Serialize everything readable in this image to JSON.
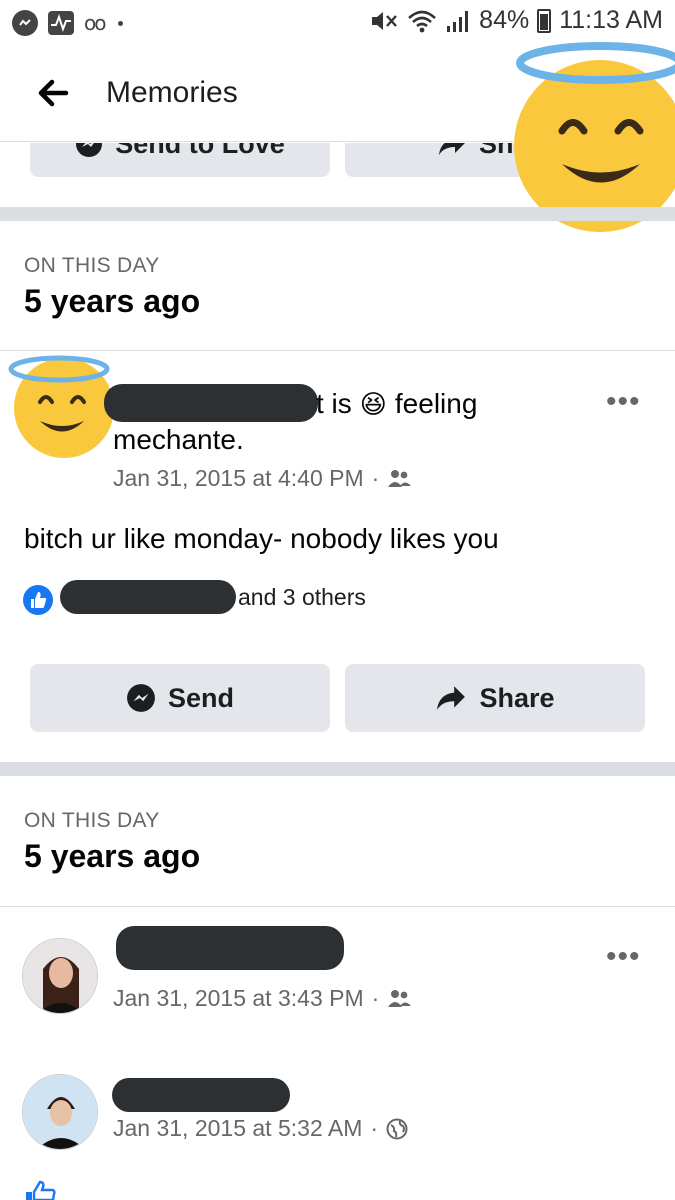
{
  "status_bar": {
    "battery": "84%",
    "time": "11:13 AM"
  },
  "app_bar": {
    "title": "Memories"
  },
  "top_partial_buttons": {
    "send_label": "Send to Love",
    "share_label": "Sh"
  },
  "sections": [
    {
      "on_this_day": "ON THIS DAY",
      "years_ago": "5 years ago",
      "post": {
        "header_mid": "t is",
        "feeling_word": "feeling",
        "feeling_emoji": "😆",
        "feeling_value": "mechante.",
        "timestamp": "Jan 31, 2015 at 4:40 PM",
        "dot": "·",
        "body": "bitch ur like monday- nobody likes you",
        "reactions_suffix": "and 3 others",
        "more": "•••",
        "send_label": "Send",
        "share_label": "Share"
      }
    },
    {
      "on_this_day": "ON THIS DAY",
      "years_ago": "5 years ago",
      "items": [
        {
          "timestamp": "Jan 31, 2015 at 3:43 PM",
          "dot": "·",
          "more": "•••"
        },
        {
          "timestamp": "Jan 31, 2015 at 5:32 AM",
          "dot": "·"
        }
      ]
    }
  ],
  "colors": {
    "accent": "#1877f2",
    "button_bg": "#e4e6eb",
    "separator": "#dadde1",
    "halo": "#6cb4e8",
    "emoji_face": "#f9c83d"
  }
}
